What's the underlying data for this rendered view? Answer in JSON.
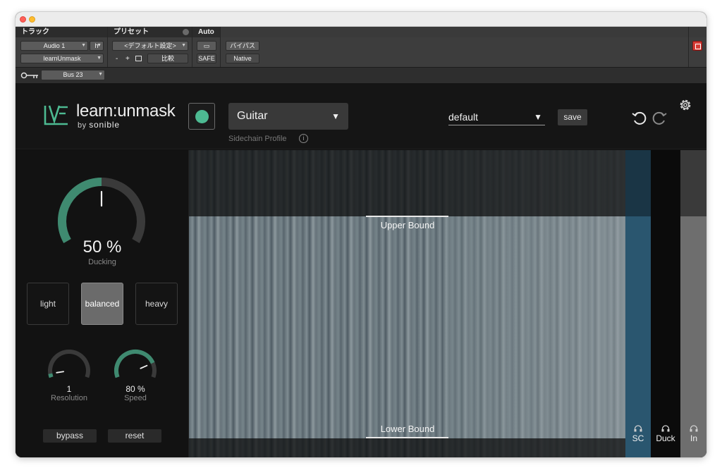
{
  "host": {
    "sections": {
      "track": "トラック",
      "preset": "プリセット",
      "auto": "Auto"
    },
    "track_name": "Audio 1",
    "track_h": "h",
    "insert_name": "learnUnmask",
    "preset_value": "<デフォルト設定>",
    "preset_minus": "-",
    "preset_plus": "+",
    "compare_label": "比較",
    "safe_label": "SAFE",
    "bypass_label": "バイパス",
    "native_label": "Native",
    "sidechain_bus": "Bus 23"
  },
  "plugin": {
    "logo_text": "learn:unmask",
    "logo_by": "by",
    "logo_brand": "sonible",
    "sidechain_profile": {
      "value": "Guitar",
      "label": "Sidechain Profile"
    },
    "preset": {
      "value": "default",
      "save_label": "save"
    },
    "ducking": {
      "value_text": "50 %",
      "label": "Ducking",
      "value": 0.5
    },
    "modes": [
      {
        "label": "light",
        "active": false
      },
      {
        "label": "balanced",
        "active": true
      },
      {
        "label": "heavy",
        "active": false
      }
    ],
    "resolution": {
      "value_text": "1",
      "label": "Resolution",
      "value": 0.05
    },
    "speed": {
      "value_text": "80 %",
      "label": "Speed",
      "value": 0.8
    },
    "bypass_label": "bypass",
    "reset_label": "reset",
    "upper_bound_label": "Upper Bound",
    "lower_bound_label": "Lower Bound",
    "columns": [
      {
        "label": "SC",
        "icon": "headphones-icon"
      },
      {
        "label": "Duck",
        "icon": "headphones-icon"
      },
      {
        "label": "In",
        "icon": "headphones-icon"
      }
    ]
  },
  "colors": {
    "accent": "#4dba92",
    "sc_column": "#2a566f"
  }
}
